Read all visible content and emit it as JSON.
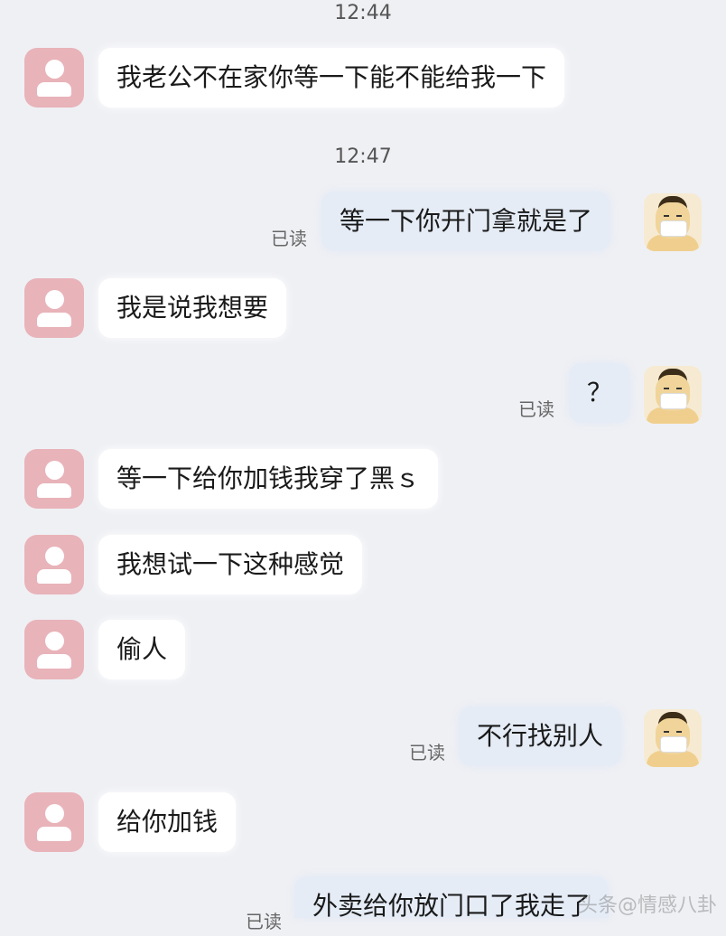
{
  "timestamps": [
    "12:44",
    "12:47"
  ],
  "messages": [
    {
      "side": "left",
      "text": "我老公不在家你等一下能不能给我一下"
    },
    {
      "side": "right",
      "text": "等一下你开门拿就是了",
      "status": "已读"
    },
    {
      "side": "left",
      "text": "我是说我想要"
    },
    {
      "side": "right",
      "text": "？",
      "status": "已读"
    },
    {
      "side": "left",
      "text": "等一下给你加钱我穿了黑ｓ"
    },
    {
      "side": "left",
      "text": "我想试一下这种感觉"
    },
    {
      "side": "left",
      "text": "偷人"
    },
    {
      "side": "right",
      "text": "不行找别人",
      "status": "已读"
    },
    {
      "side": "left",
      "text": "给你加钱"
    },
    {
      "side": "right",
      "text": "外卖给你放门口了我走了",
      "status": "已读"
    }
  ],
  "watermark": "头条@情感八卦"
}
